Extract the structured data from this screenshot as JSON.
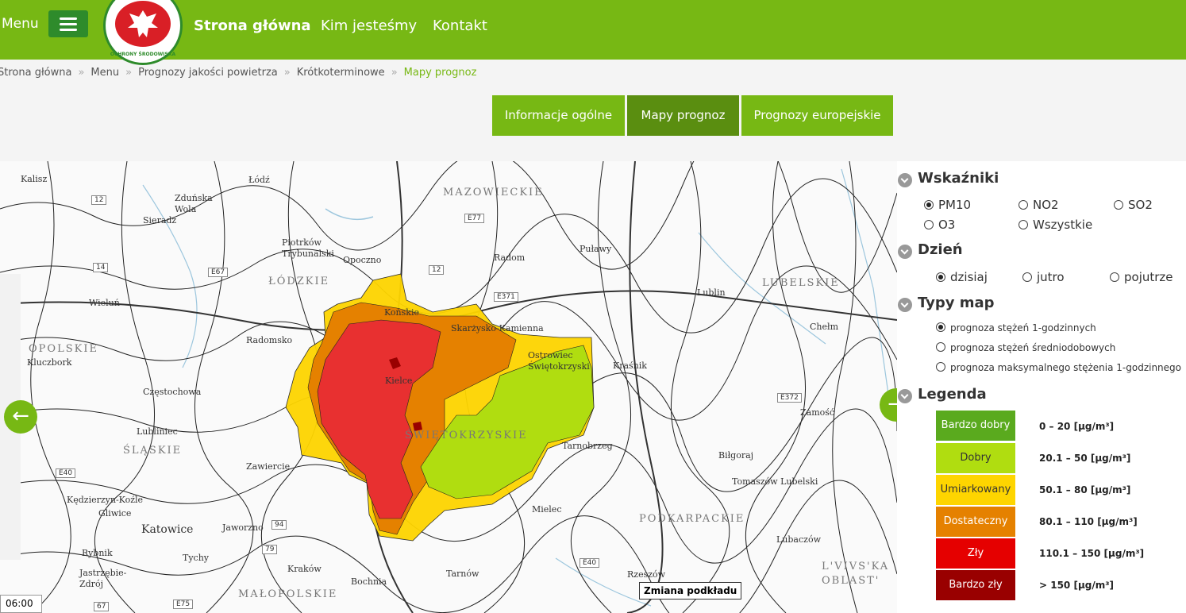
{
  "header": {
    "menu_label": "Menu",
    "logo_text": "OCHRONY ŚRODOWISKA",
    "nav": [
      "Strona główna",
      "Kim jesteśmy",
      "Kontakt"
    ]
  },
  "breadcrumb": [
    "Strona główna",
    "Menu",
    "Prognozy jakości powietrza",
    "Krótkoterminowe",
    "Mapy prognoz"
  ],
  "tabs": [
    "Informacje ogólne",
    "Mapy prognoz",
    "Prognozy europejskie"
  ],
  "map": {
    "change_bg": "Zmiana podkładu",
    "time": "06:00",
    "prev_icon": "arrow-left-icon",
    "next_icon": "arrow-right-icon",
    "regions": [
      "MAZOWIECKIE",
      "ŁÓDZKIE",
      "LUBELSKIE",
      "OPOLSKIE",
      "ŚLĄSKIE",
      "ŚWIĘTOKRZYSKIE",
      "PODKARPACKIE",
      "MAŁOPOLSKIE",
      "L'VIVS'KA OBLAST'"
    ],
    "cities": [
      "Kalisz",
      "Łódź",
      "Zduńska Wola",
      "Sieradz",
      "Piotrków Trybunalski",
      "Opoczno",
      "Radom",
      "Puławy",
      "Wieluń",
      "Radomsko",
      "Końskie",
      "Skarżysko-Kamienna",
      "Ostrowiec Świętokrzyski",
      "Kraśnik",
      "Lublin",
      "Chełm",
      "Kluczbork",
      "Częstochowa",
      "Kielce",
      "Zamość",
      "Lubliniec",
      "Zawiercie",
      "Tarnobrzeg",
      "Biłgoraj",
      "Tomaszów Lubelski",
      "Kędzierzyn-Koźle",
      "Gliwice",
      "Katowice",
      "Jaworzno",
      "Mielec",
      "Rybnik",
      "Tychy",
      "Jastrzębie-Zdrój",
      "Kraków",
      "Tarnów",
      "Rzeszów",
      "Lubaczów",
      "Bochnia"
    ],
    "roads": [
      "12",
      "14",
      "E67",
      "E77",
      "12",
      "E371",
      "E372",
      "E40",
      "E40",
      "79",
      "94",
      "67",
      "E75"
    ]
  },
  "panel": {
    "indicators": {
      "title": "Wskaźniki",
      "options": [
        "PM10",
        "NO2",
        "SO2",
        "O3",
        "Wszystkie"
      ],
      "selected": "PM10"
    },
    "day": {
      "title": "Dzień",
      "options": [
        "dzisiaj",
        "jutro",
        "pojutrze"
      ],
      "selected": "dzisiaj"
    },
    "map_types": {
      "title": "Typy map",
      "options": [
        "prognoza stężeń 1-godzinnych",
        "prognoza stężeń średniodobowych",
        "prognoza maksymalnego stężenia 1-godzinnego"
      ],
      "selected": "prognoza stężeń 1-godzinnych"
    },
    "legend": {
      "title": "Legenda",
      "items": [
        {
          "label": "Bardzo dobry",
          "range": "0 – 20 [μg/m³]",
          "color": "#5aaa1e"
        },
        {
          "label": "Dobry",
          "range": "20.1 – 50 [μg/m³]",
          "color": "#b0dd10"
        },
        {
          "label": "Umiarkowany",
          "range": "50.1 – 80 [μg/m³]",
          "color": "#fed500"
        },
        {
          "label": "Dostateczny",
          "range": "80.1 – 110 [μg/m³]",
          "color": "#e58100"
        },
        {
          "label": "Zły",
          "range": "110.1 – 150 [μg/m³]",
          "color": "#e50000"
        },
        {
          "label": "Bardzo zły",
          "range": "> 150 [μg/m³]",
          "color": "#990000"
        }
      ]
    }
  }
}
